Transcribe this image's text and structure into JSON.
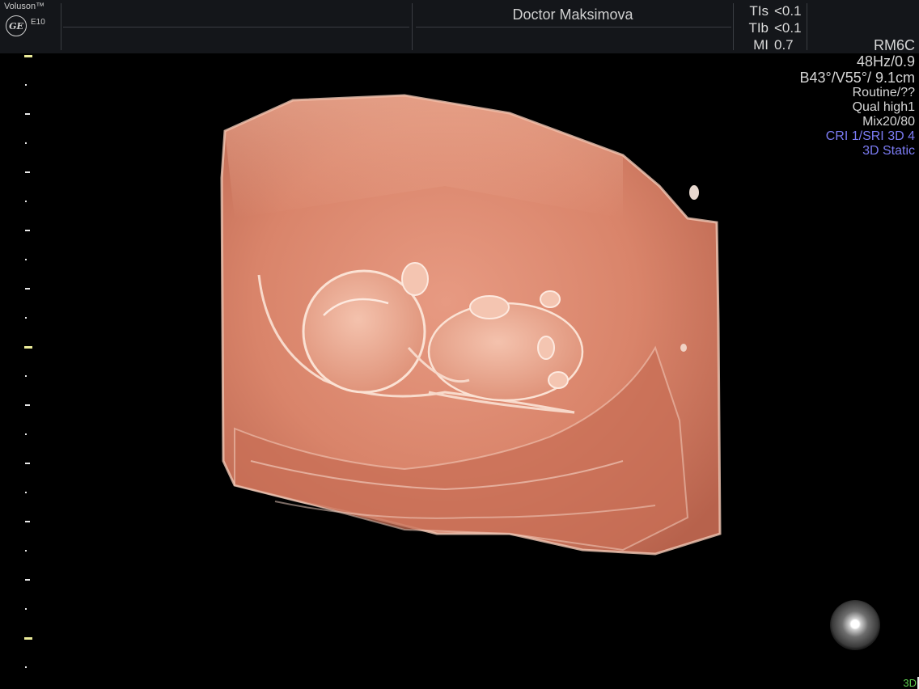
{
  "header": {
    "brand": "Voluson™",
    "logo": "GE",
    "model": "E10",
    "operator": "Doctor Maksimova",
    "safety": [
      {
        "label": "TIs",
        "value": "<0.1"
      },
      {
        "label": "TIb",
        "value": "<0.1"
      },
      {
        "label": "MI",
        "value": "0.7"
      }
    ]
  },
  "params": {
    "probe": "RM6C",
    "frame": "48Hz/0.9",
    "geometry": "B43°/V55°/ 9.1cm",
    "preset": "Routine/??",
    "quality": "Qual high1",
    "mix": "Mix20/80",
    "cri": "CRI 1/SRI 3D 4",
    "mode": "3D Static"
  },
  "footer": {
    "mode_label": "3D"
  },
  "scale": {
    "ticks": 22,
    "major_every": 10,
    "mid_every": 2
  },
  "colors": {
    "accent_blue": "#7b7bf3",
    "tissue": "#d98a72",
    "mode_green": "#5fcf4f"
  }
}
